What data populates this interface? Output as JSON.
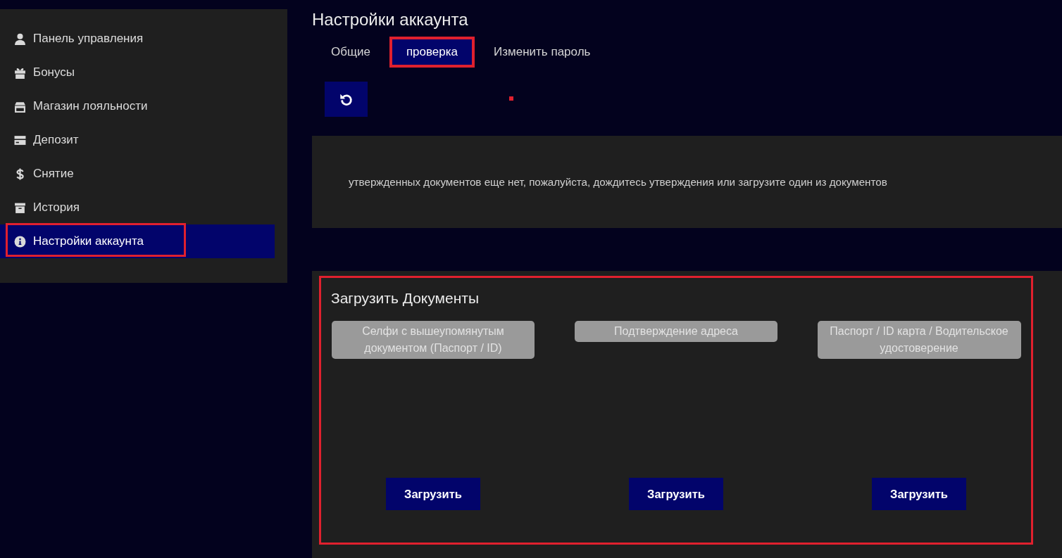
{
  "sidebar": {
    "items": [
      {
        "label": "Панель управления",
        "selected": false,
        "highlighted": false
      },
      {
        "label": "Бонусы",
        "selected": false,
        "highlighted": false
      },
      {
        "label": "Магазин лояльности",
        "selected": false,
        "highlighted": false
      },
      {
        "label": "Депозит",
        "selected": false,
        "highlighted": false
      },
      {
        "label": "Снятие",
        "selected": false,
        "highlighted": false
      },
      {
        "label": "История",
        "selected": false,
        "highlighted": false
      },
      {
        "label": "Настройки аккаунта",
        "selected": true,
        "highlighted": true
      }
    ]
  },
  "page_title": "Настройки аккаунта",
  "tabs": [
    {
      "label": "Общие",
      "selected": false,
      "highlighted": false
    },
    {
      "label": "проверка",
      "selected": true,
      "highlighted": true
    },
    {
      "label": "Изменить пароль",
      "selected": false,
      "highlighted": false
    }
  ],
  "toolbar": {
    "marker": true
  },
  "notice": "утвержденных документов еще нет, пожалуйста, дождитесь утверждения или загрузите один из документов",
  "upload": {
    "title": "Загрузить Документы",
    "highlighted": true,
    "documents": [
      {
        "label": "Селфи с вышеупомянутым документом (Паспорт / ID)",
        "button": "Загрузить"
      },
      {
        "label": "Подтверждение адреса",
        "button": "Загрузить"
      },
      {
        "label": "Паспорт / ID карта / Водительское удостоверение",
        "button": "Загрузить"
      }
    ]
  }
}
